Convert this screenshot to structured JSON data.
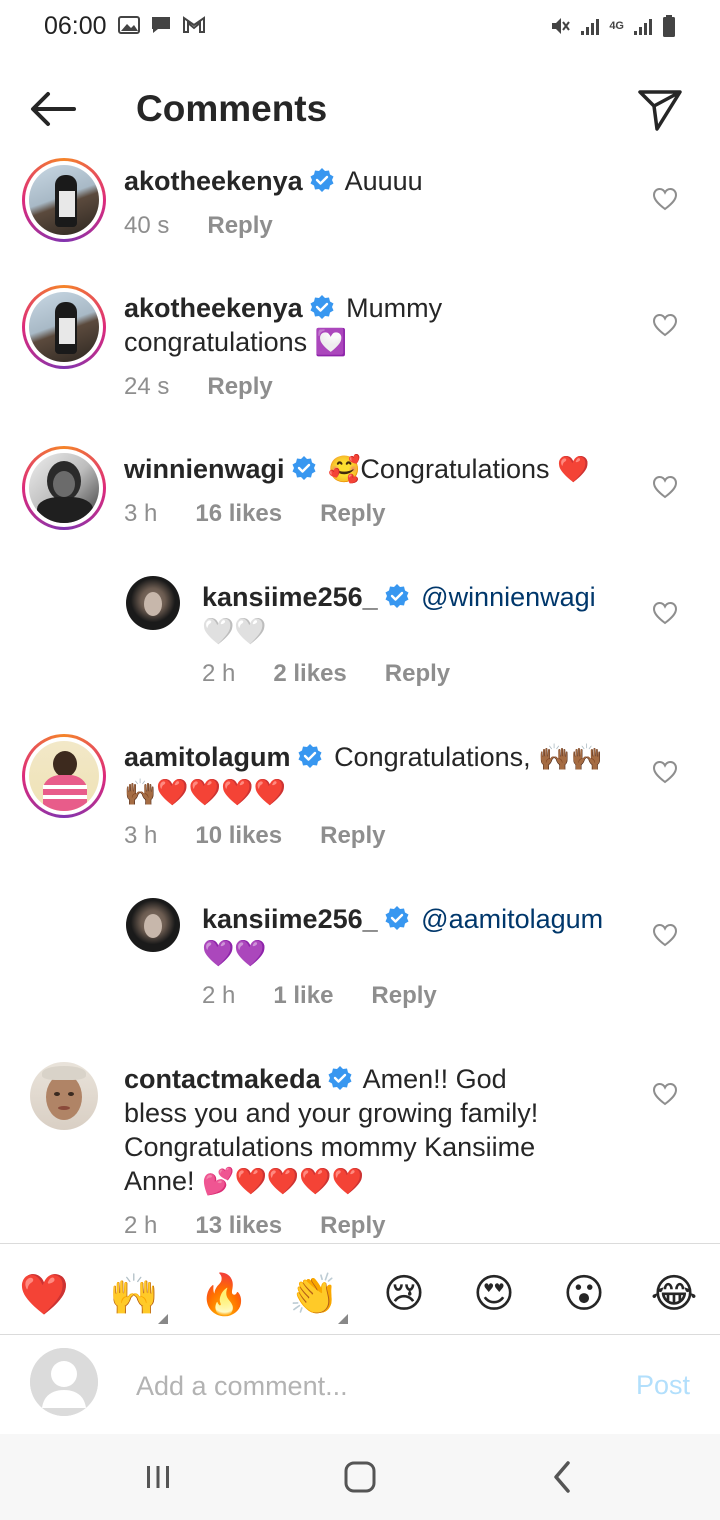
{
  "status_bar": {
    "time": "06:00",
    "network": "4G"
  },
  "header": {
    "title": "Comments"
  },
  "comments": [
    {
      "username": "akotheekenya",
      "text": "Auuuu",
      "time": "40 s",
      "likes": "",
      "reply": "Reply"
    },
    {
      "username": "akotheekenya",
      "text_line1": "Mummy",
      "text_line2": "congratulations",
      "emoji": "💟",
      "time": "24 s",
      "likes": "",
      "reply": "Reply"
    },
    {
      "username": "winnienwagi",
      "emoji_pre": "🥰",
      "text": "Congratulations",
      "emoji": "❤️",
      "time": "3 h",
      "likes": "16 likes",
      "reply": "Reply"
    },
    {
      "username": "kansiime256_",
      "mention": "@winnienwagi",
      "emoji": "🤍🤍",
      "time": "2 h",
      "likes": "2 likes",
      "reply": "Reply"
    },
    {
      "username": "aamitolagum",
      "text": "Congratulations,",
      "emoji_inline": "🙌🏾🙌🏾",
      "emoji_line2": "🙌🏾❤️❤️❤️❤️",
      "time": "3 h",
      "likes": "10 likes",
      "reply": "Reply"
    },
    {
      "username": "kansiime256_",
      "mention": "@aamitolagum",
      "emoji": "💜💜",
      "time": "2 h",
      "likes": "1 like",
      "reply": "Reply"
    },
    {
      "username": "contactmakeda",
      "text_line1": "Amen!! God",
      "text_line2": "bless you and your growing family!",
      "text_line3": "Congratulations mommy Kansiime",
      "text_line4": "Anne!",
      "emoji": "💕❤️❤️❤️❤️",
      "time": "2 h",
      "likes": "13 likes",
      "reply": "Reply"
    }
  ],
  "reactions": [
    "❤️",
    "🙌",
    "🔥",
    "👏",
    "😢",
    "😍",
    "😮",
    "😂"
  ],
  "composer": {
    "placeholder": "Add a comment...",
    "post_label": "Post"
  },
  "colors": {
    "verified": "#3897f0",
    "mention": "#00376b",
    "post_disabled": "#b2dffc",
    "meta": "#8e8e8e"
  }
}
